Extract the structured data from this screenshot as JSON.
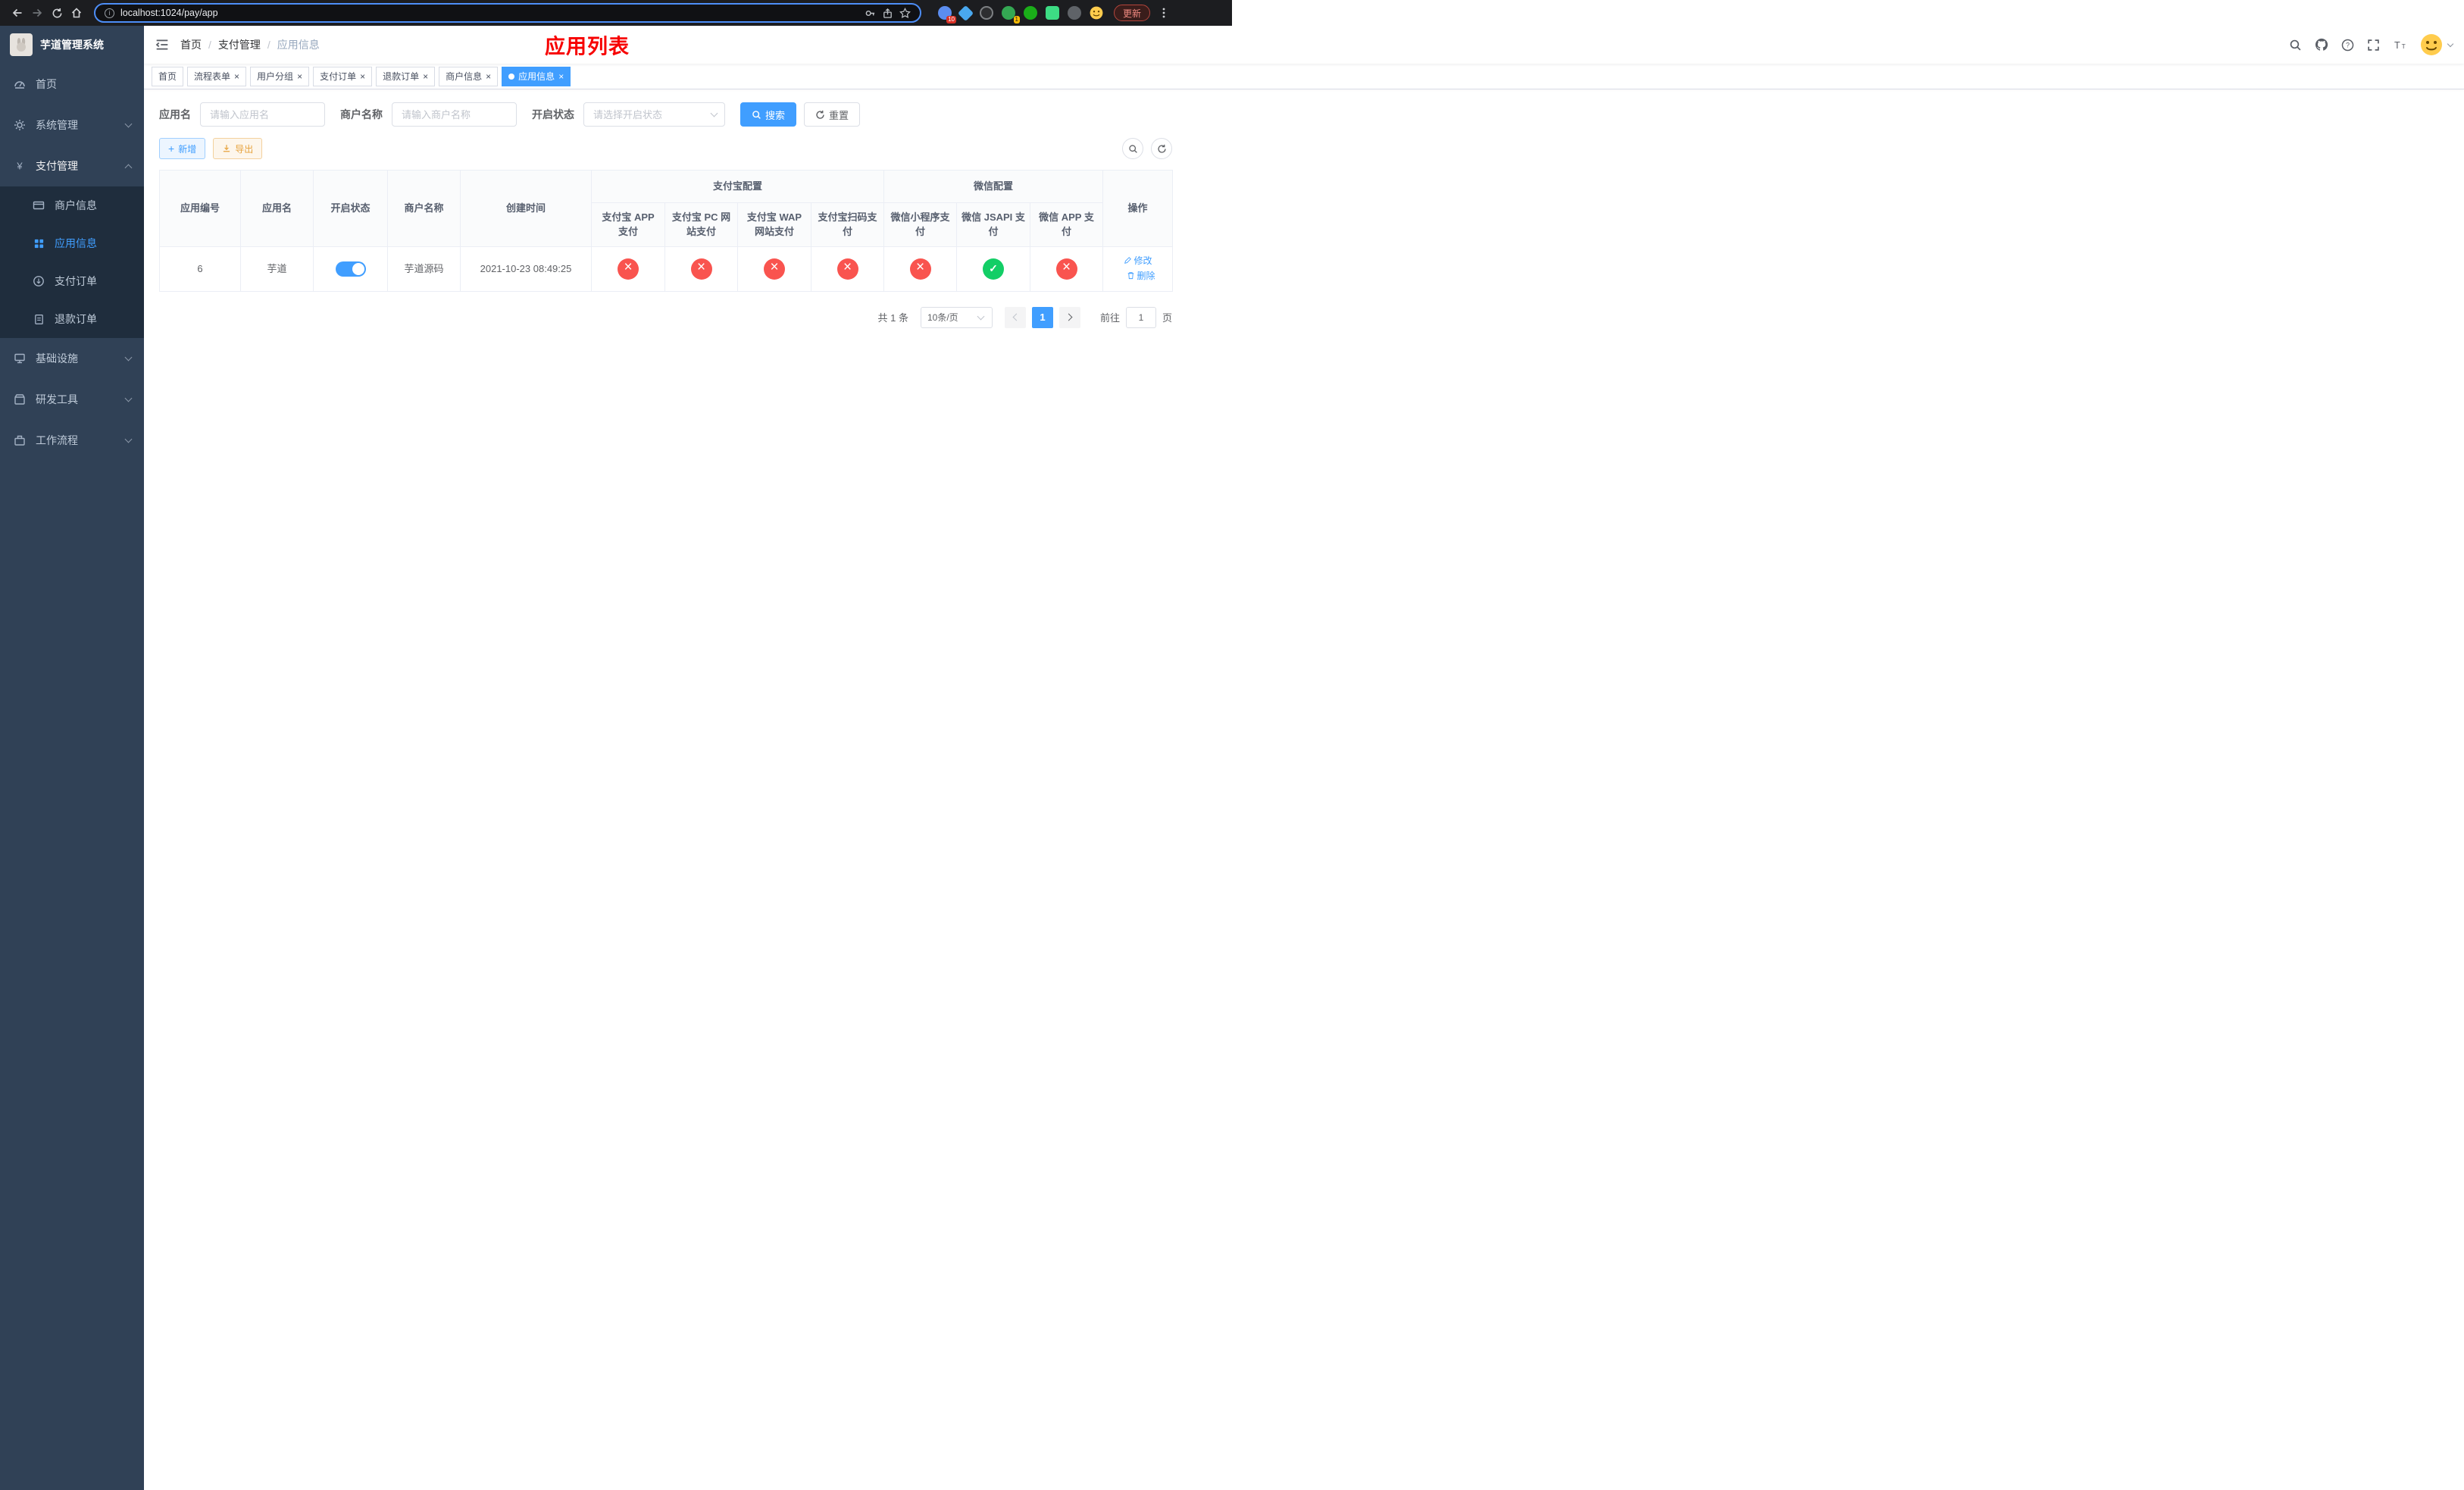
{
  "colors": {
    "accent_blue": "#409eff",
    "success_green": "#13ce66",
    "danger_red": "#f9544f",
    "warning_orange": "#e6a23c",
    "title_red": "#f70000",
    "sidebar_bg": "#304156",
    "submenu_bg": "#1f2d3d"
  },
  "browser": {
    "url": "localhost:1024/pay/app",
    "update_label": "更新",
    "extension_badge_blue": "10",
    "extension_badge_green": "1"
  },
  "sidebar": {
    "title": "芋道管理系统",
    "items": [
      {
        "label": "首页"
      },
      {
        "label": "系统管理"
      },
      {
        "label": "支付管理"
      },
      {
        "label": "基础设施"
      },
      {
        "label": "研发工具"
      },
      {
        "label": "工作流程"
      }
    ],
    "payment_children": [
      {
        "label": "商户信息"
      },
      {
        "label": "应用信息"
      },
      {
        "label": "支付订单"
      },
      {
        "label": "退款订单"
      }
    ]
  },
  "navbar": {
    "breadcrumb": [
      "首页",
      "支付管理",
      "应用信息"
    ],
    "page_title": "应用列表"
  },
  "tabs": [
    {
      "label": "首页"
    },
    {
      "label": "流程表单"
    },
    {
      "label": "用户分组"
    },
    {
      "label": "支付订单"
    },
    {
      "label": "退款订单"
    },
    {
      "label": "商户信息"
    },
    {
      "label": "应用信息"
    }
  ],
  "filters": {
    "app_name_label": "应用名",
    "app_name_placeholder": "请输入应用名",
    "merchant_label": "商户名称",
    "merchant_placeholder": "请输入商户名称",
    "status_label": "开启状态",
    "status_placeholder": "请选择开启状态",
    "search_label": "搜索",
    "reset_label": "重置"
  },
  "toolbar": {
    "add_label": "新增",
    "export_label": "导出"
  },
  "table": {
    "groups": {
      "alipay": "支付宝配置",
      "wechat": "微信配置"
    },
    "columns": {
      "app_id": "应用编号",
      "app_name": "应用名",
      "status": "开启状态",
      "merchant": "商户名称",
      "created": "创建时间",
      "alipay_app": "支付宝 APP 支付",
      "alipay_pc": "支付宝 PC 网站支付",
      "alipay_wap": "支付宝 WAP 网站支付",
      "alipay_qr": "支付宝扫码支付",
      "wx_mini": "微信小程序支付",
      "wx_jsapi": "微信 JSAPI 支付",
      "wx_app": "微信 APP 支付",
      "ops": "操作"
    },
    "rows": [
      {
        "app_id": "6",
        "app_name": "芋道",
        "status_on": true,
        "merchant": "芋道源码",
        "created": "2021-10-23 08:49:25",
        "configs": [
          false,
          false,
          false,
          false,
          false,
          true,
          false
        ],
        "edit_label": "修改",
        "delete_label": "删除"
      }
    ]
  },
  "pagination": {
    "total": "共 1 条",
    "page_size": "10条/页",
    "current_page": "1",
    "goto_label": "前往",
    "goto_value": "1",
    "unit_label": "页"
  }
}
